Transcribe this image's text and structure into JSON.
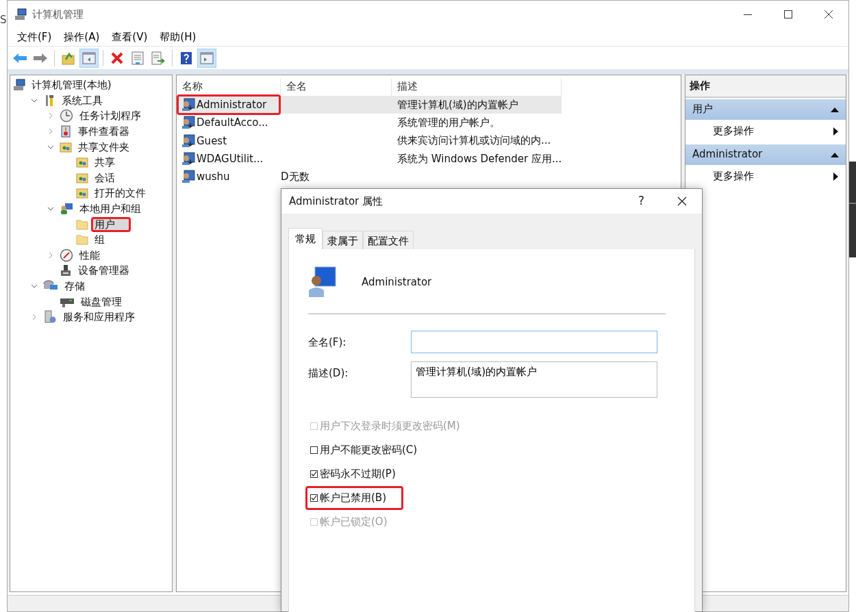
{
  "background": {
    "text": "S"
  },
  "window": {
    "title": "计算机管理"
  },
  "menu": [
    "文件(F)",
    "操作(A)",
    "查看(V)",
    "帮助(H)"
  ],
  "toolbar": [
    {
      "kind": "back",
      "pressed": false
    },
    {
      "kind": "forward",
      "pressed": false
    },
    {
      "kind": "separator"
    },
    {
      "kind": "up",
      "pressed": false
    },
    {
      "kind": "panel-left",
      "pressed": true
    },
    {
      "kind": "separator"
    },
    {
      "kind": "delete",
      "pressed": false
    },
    {
      "kind": "properties",
      "pressed": false
    },
    {
      "kind": "export",
      "pressed": false
    },
    {
      "kind": "separator"
    },
    {
      "kind": "help",
      "pressed": false
    },
    {
      "kind": "panel-right",
      "pressed": true
    }
  ],
  "tree": [
    {
      "label": "计算机管理(本地)",
      "kind": "computer",
      "selected": false,
      "annotated": false,
      "children": [
        {
          "label": "系统工具",
          "kind": "tools",
          "expanded": true,
          "selected": false,
          "annotated": false,
          "children": [
            {
              "label": "任务计划程序",
              "kind": "clock",
              "expanded": false,
              "selected": false,
              "annotated": false
            },
            {
              "label": "事件查看器",
              "kind": "log",
              "expanded": false,
              "selected": false,
              "annotated": false
            },
            {
              "label": "共享文件夹",
              "kind": "share",
              "expanded": true,
              "selected": false,
              "annotated": false,
              "children": [
                {
                  "label": "共享",
                  "kind": "share",
                  "selected": false,
                  "annotated": false
                },
                {
                  "label": "会话",
                  "kind": "share",
                  "selected": false,
                  "annotated": false
                },
                {
                  "label": "打开的文件",
                  "kind": "share",
                  "selected": false,
                  "annotated": false
                }
              ]
            },
            {
              "label": "本地用户和组",
              "kind": "users",
              "expanded": true,
              "selected": false,
              "annotated": false,
              "children": [
                {
                  "label": "用户",
                  "kind": "folder",
                  "selected": true,
                  "annotated": true
                },
                {
                  "label": "组",
                  "kind": "folder",
                  "selected": false,
                  "annotated": false
                }
              ]
            },
            {
              "label": "性能",
              "kind": "perf",
              "expanded": false,
              "selected": false,
              "annotated": false
            },
            {
              "label": "设备管理器",
              "kind": "device",
              "selected": false,
              "annotated": false
            }
          ]
        },
        {
          "label": "存储",
          "kind": "storage",
          "expanded": true,
          "selected": false,
          "annotated": false,
          "children": [
            {
              "label": "磁盘管理",
              "kind": "disk",
              "selected": false,
              "annotated": false
            }
          ]
        },
        {
          "label": "服务和应用程序",
          "kind": "services",
          "expanded": false,
          "selected": false,
          "annotated": false
        }
      ]
    }
  ],
  "table": {
    "columns": [
      "名称",
      "全名",
      "描述"
    ],
    "rows": [
      {
        "name": "Administrator",
        "description": "管理计算机(域)的内置帐户",
        "kind": "user",
        "selected": true,
        "annotated": true
      },
      {
        "name": "DefaultAcco...",
        "description": "系统管理的用户帐户。",
        "kind": "user",
        "selected": false,
        "annotated": false
      },
      {
        "name": "Guest",
        "description": "供来宾访问计算机或访问域的内...",
        "kind": "user",
        "selected": false,
        "annotated": false
      },
      {
        "name": "WDAGUtilit...",
        "description": "系统为 Windows Defender 应用...",
        "kind": "user",
        "selected": false,
        "annotated": false
      },
      {
        "name": "wushu",
        "full_name": "D无数",
        "kind": "user-plain",
        "selected": false,
        "annotated": false
      }
    ]
  },
  "actions": {
    "title": "操作",
    "sections": [
      {
        "title": "用户",
        "items": [
          "更多操作"
        ]
      },
      {
        "title": "Administrator",
        "items": [
          "更多操作"
        ]
      }
    ]
  },
  "dialog": {
    "title": "Administrator 属性",
    "help": "?",
    "tabs": [
      {
        "label": "常规",
        "selected": true
      },
      {
        "label": "隶属于",
        "selected": false
      },
      {
        "label": "配置文件",
        "selected": false
      }
    ],
    "user_name": "Administrator",
    "fields": [
      {
        "label": "全名(F):",
        "kind": "line",
        "focused": true
      },
      {
        "label": "描述(D):",
        "value": "管理计算机(域)的内置帐户",
        "kind": "area",
        "focused": false
      }
    ],
    "checkboxes": [
      {
        "label": "用户下次登录时须更改密码(M)",
        "checked": false,
        "disabled": true,
        "annotated": false
      },
      {
        "label": "用户不能更改密码(C)",
        "checked": false,
        "disabled": false,
        "annotated": false
      },
      {
        "label": "密码永不过期(P)",
        "checked": true,
        "disabled": false,
        "annotated": false
      },
      {
        "label": "帐户已禁用(B)",
        "checked": true,
        "disabled": false,
        "annotated": true
      },
      {
        "label": "帐户已锁定(O)",
        "checked": false,
        "disabled": true,
        "annotated": false
      }
    ]
  }
}
